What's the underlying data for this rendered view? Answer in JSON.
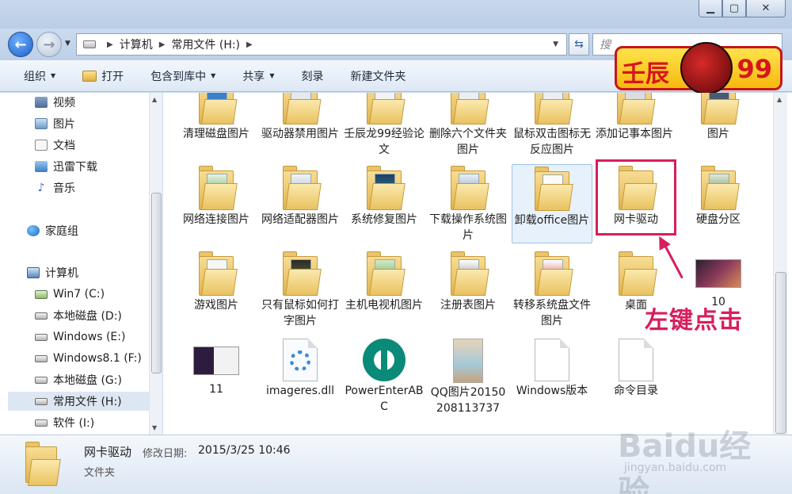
{
  "address": {
    "crumbs": [
      "计算机",
      "常用文件 (H:)"
    ]
  },
  "search": {
    "placeholder": "搜"
  },
  "toolbar": {
    "organize": "组织",
    "open": "打开",
    "include_library": "包含到库中",
    "share": "共享",
    "burn": "刻录",
    "new_folder": "新建文件夹"
  },
  "sidebar": {
    "items": [
      {
        "label": "视频",
        "icon": "video-icon"
      },
      {
        "label": "图片",
        "icon": "pictures-icon"
      },
      {
        "label": "文档",
        "icon": "documents-icon"
      },
      {
        "label": "迅雷下载",
        "icon": "thunder-download-icon"
      },
      {
        "label": "音乐",
        "icon": "music-icon"
      },
      {
        "label": "家庭组",
        "icon": "homegroup-icon"
      },
      {
        "label": "计算机",
        "icon": "computer-icon"
      },
      {
        "label": "Win7 (C:)",
        "icon": "drive-icon"
      },
      {
        "label": "本地磁盘 (D:)",
        "icon": "drive-icon"
      },
      {
        "label": "Windows (E:)",
        "icon": "drive-icon"
      },
      {
        "label": "Windows8.1 (F:)",
        "icon": "drive-icon"
      },
      {
        "label": "本地磁盘 (G:)",
        "icon": "drive-icon"
      },
      {
        "label": "常用文件 (H:)",
        "icon": "drive-icon",
        "selected": true
      },
      {
        "label": "软件 (I:)",
        "icon": "drive-icon"
      }
    ]
  },
  "files": {
    "row1": [
      "清理磁盘图片",
      "驱动器禁用图片",
      "壬辰龙99经验论文",
      "删除六个文件夹图片",
      "鼠标双击图标无反应图片",
      "添加记事本图片",
      "图片"
    ],
    "row2": [
      "网络连接图片",
      "网络适配器图片",
      "系统修复图片",
      "下载操作系统图片",
      "卸载office图片",
      "网卡驱动",
      "硬盘分区"
    ],
    "row3": [
      "游戏图片",
      "只有鼠标如何打字图片",
      "主机电视机图片",
      "注册表图片",
      "转移系统盘文件图片",
      "桌面",
      "10"
    ],
    "row4": [
      "11",
      "imageres.dll",
      "PowerEnterABC",
      "QQ图片20150208113737",
      "Windows版本",
      "命令目录"
    ]
  },
  "annotation": "左键点击",
  "logo": {
    "text_left": "壬辰",
    "text_right": "99"
  },
  "details": {
    "name": "网卡驱动",
    "modified_label": "修改日期:",
    "modified_value": "2015/3/25 10:46",
    "type": "文件夹"
  },
  "watermark": {
    "brand": "Baidu经验",
    "url": "jingyan.baidu.com"
  },
  "colors": {
    "accent": "#d81e5b",
    "selection": "#dde7f3"
  }
}
